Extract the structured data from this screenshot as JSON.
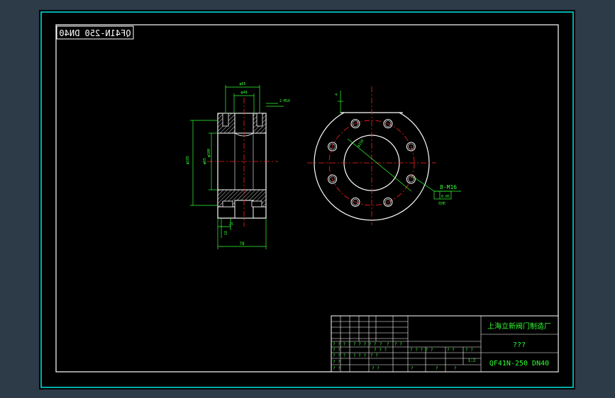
{
  "window": {
    "background": "#2d3a48",
    "drawing_area_color": "#000000",
    "border_color": "#00e5e5"
  },
  "drawing": {
    "mirrored_title": "QF41N-250 DN40",
    "side_view": {
      "dim_top_width": "φ65",
      "dim_inner": "φ48",
      "dim_side": "2-M16",
      "dim_left_height": "φ185",
      "dim_center": "φ65",
      "dim_mid": "φ100",
      "dim_bottom_left": "18",
      "dim_bottom_mid": "25",
      "dim_overall_width": "78"
    },
    "front_view": {
      "dim_small": "4",
      "dim_pitch": "φ150",
      "callout_thread": "8-M16",
      "callout_box": "0.05",
      "callout_sub": "均布"
    }
  },
  "title_block": {
    "company": "上海立新阀门制造厂",
    "part_name": "???",
    "drawing_number": "QF41N-250 DN40",
    "scale": "1:2",
    "row_labels": [
      "? ? ? ? ? ? ? ? ?",
      "? ?",
      "? ? ?",
      "? ? ? ? ? ? ?",
      "? ?",
      "? ? ? ? ?"
    ],
    "header_marks": [
      "? ?",
      "? ?",
      "? ?",
      "? ?",
      "?",
      "?"
    ],
    "bottom_marks": [
      "? ?",
      "? ?",
      "?",
      "?",
      "?"
    ]
  }
}
